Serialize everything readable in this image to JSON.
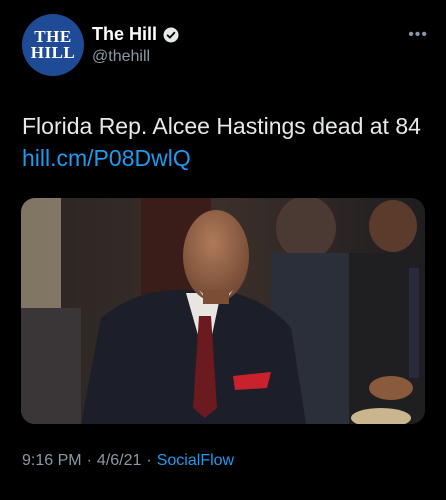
{
  "account": {
    "avatar_line1": "THE",
    "avatar_line2": "HILL",
    "name": "The Hill",
    "handle": "@thehill",
    "verified_icon": "verified-badge-icon",
    "more_icon": "more-options-icon"
  },
  "tweet": {
    "text": "Florida Rep. Alcee Hastings dead at 84",
    "link": "hill.cm/P08DwlQ"
  },
  "meta": {
    "time": "9:16 PM",
    "separator1": "·",
    "date": "4/6/21",
    "separator2": "·",
    "source": "SocialFlow"
  },
  "colors": {
    "background": "#000000",
    "link": "#1d9bf0",
    "secondary": "#8b98a5",
    "avatar": "#1f4b96"
  }
}
